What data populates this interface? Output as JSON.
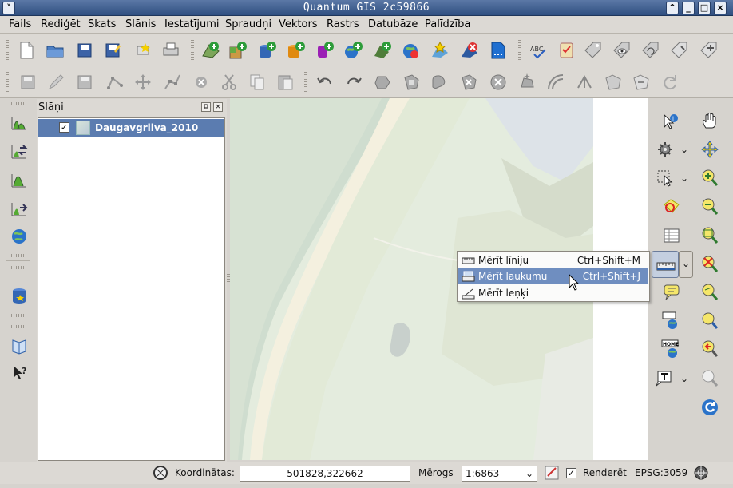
{
  "window": {
    "title": "Quantum GIS 2c59866"
  },
  "menubar": [
    "Fails",
    "Rediģēt",
    "Skats",
    "Slānis",
    "Iestatījumi",
    "Spraudņi",
    "Vektors",
    "Rastrs",
    "Datubāze",
    "Palīdzība"
  ],
  "layers_panel": {
    "title": "Slāņi",
    "layers": [
      {
        "name": "Daugavgriiva_2010",
        "checked": "✓"
      }
    ]
  },
  "measure_menu": {
    "items": [
      {
        "label": "Mērīt līniju",
        "shortcut": "Ctrl+Shift+M"
      },
      {
        "label": "Mērīt laukumu",
        "shortcut": "Ctrl+Shift+J"
      },
      {
        "label": "Mērīt leņķi",
        "shortcut": ""
      }
    ]
  },
  "statusbar": {
    "coordinates_label": "Koordinātas:",
    "coordinates_value": "501828,322662",
    "scale_label": "Mērogs",
    "scale_value": "1:6863",
    "render_label": "Renderēt",
    "render_checked": "✓",
    "crs": "EPSG:3059"
  },
  "labels": {
    "abc": "ABC",
    "home": "HOME"
  },
  "colors": {
    "selection": "#5b7cb0",
    "menu_active": "#6f8ec0",
    "title_bar": "#3d5a8c"
  }
}
